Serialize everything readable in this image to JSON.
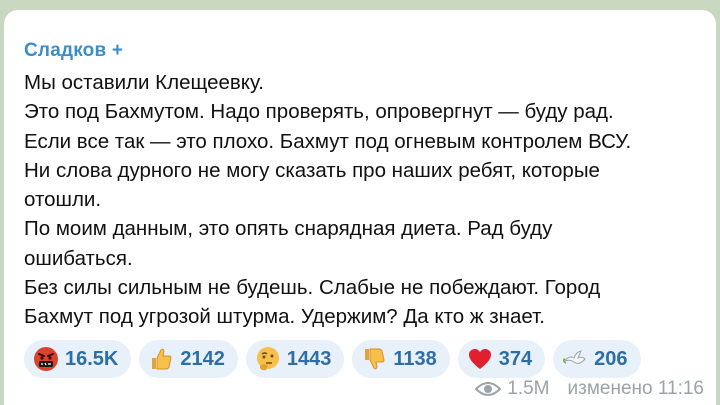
{
  "post": {
    "author": "Сладков +",
    "lines": [
      "Мы оставили Клещеевку.",
      "Это под Бахмутом. Надо проверять, опровергнут — буду рад.",
      "Если все так — это плохо. Бахмут под огневым контролем ВСУ.",
      "Ни слова дурного не могу сказать про наших ребят, которые",
      "отошли.",
      "По моим данным, это опять снарядная диета. Рад буду",
      "ошибаться.",
      "Без силы сильным не будешь. Слабые не побеждают. Город",
      "Бахмут под угрозой штурма. Удержим? Да кто ж знает."
    ]
  },
  "reactions": [
    {
      "icon": "cursing-face-icon",
      "count": "16.5K"
    },
    {
      "icon": "thumbs-up-icon",
      "count": "2142"
    },
    {
      "icon": "thinking-face-icon",
      "count": "1443"
    },
    {
      "icon": "thumbs-down-icon",
      "count": "1138"
    },
    {
      "icon": "red-heart-icon",
      "count": "374"
    },
    {
      "icon": "dove-icon",
      "count": "206"
    }
  ],
  "footer": {
    "views": "1.5M",
    "edited": "изменено 11:16"
  },
  "colors": {
    "background": "#c9d8c1",
    "author": "#3a8ec9",
    "reaction_bg": "#e8f1fa",
    "reaction_text": "#2d6ea3",
    "meta": "#9aa3aa"
  }
}
